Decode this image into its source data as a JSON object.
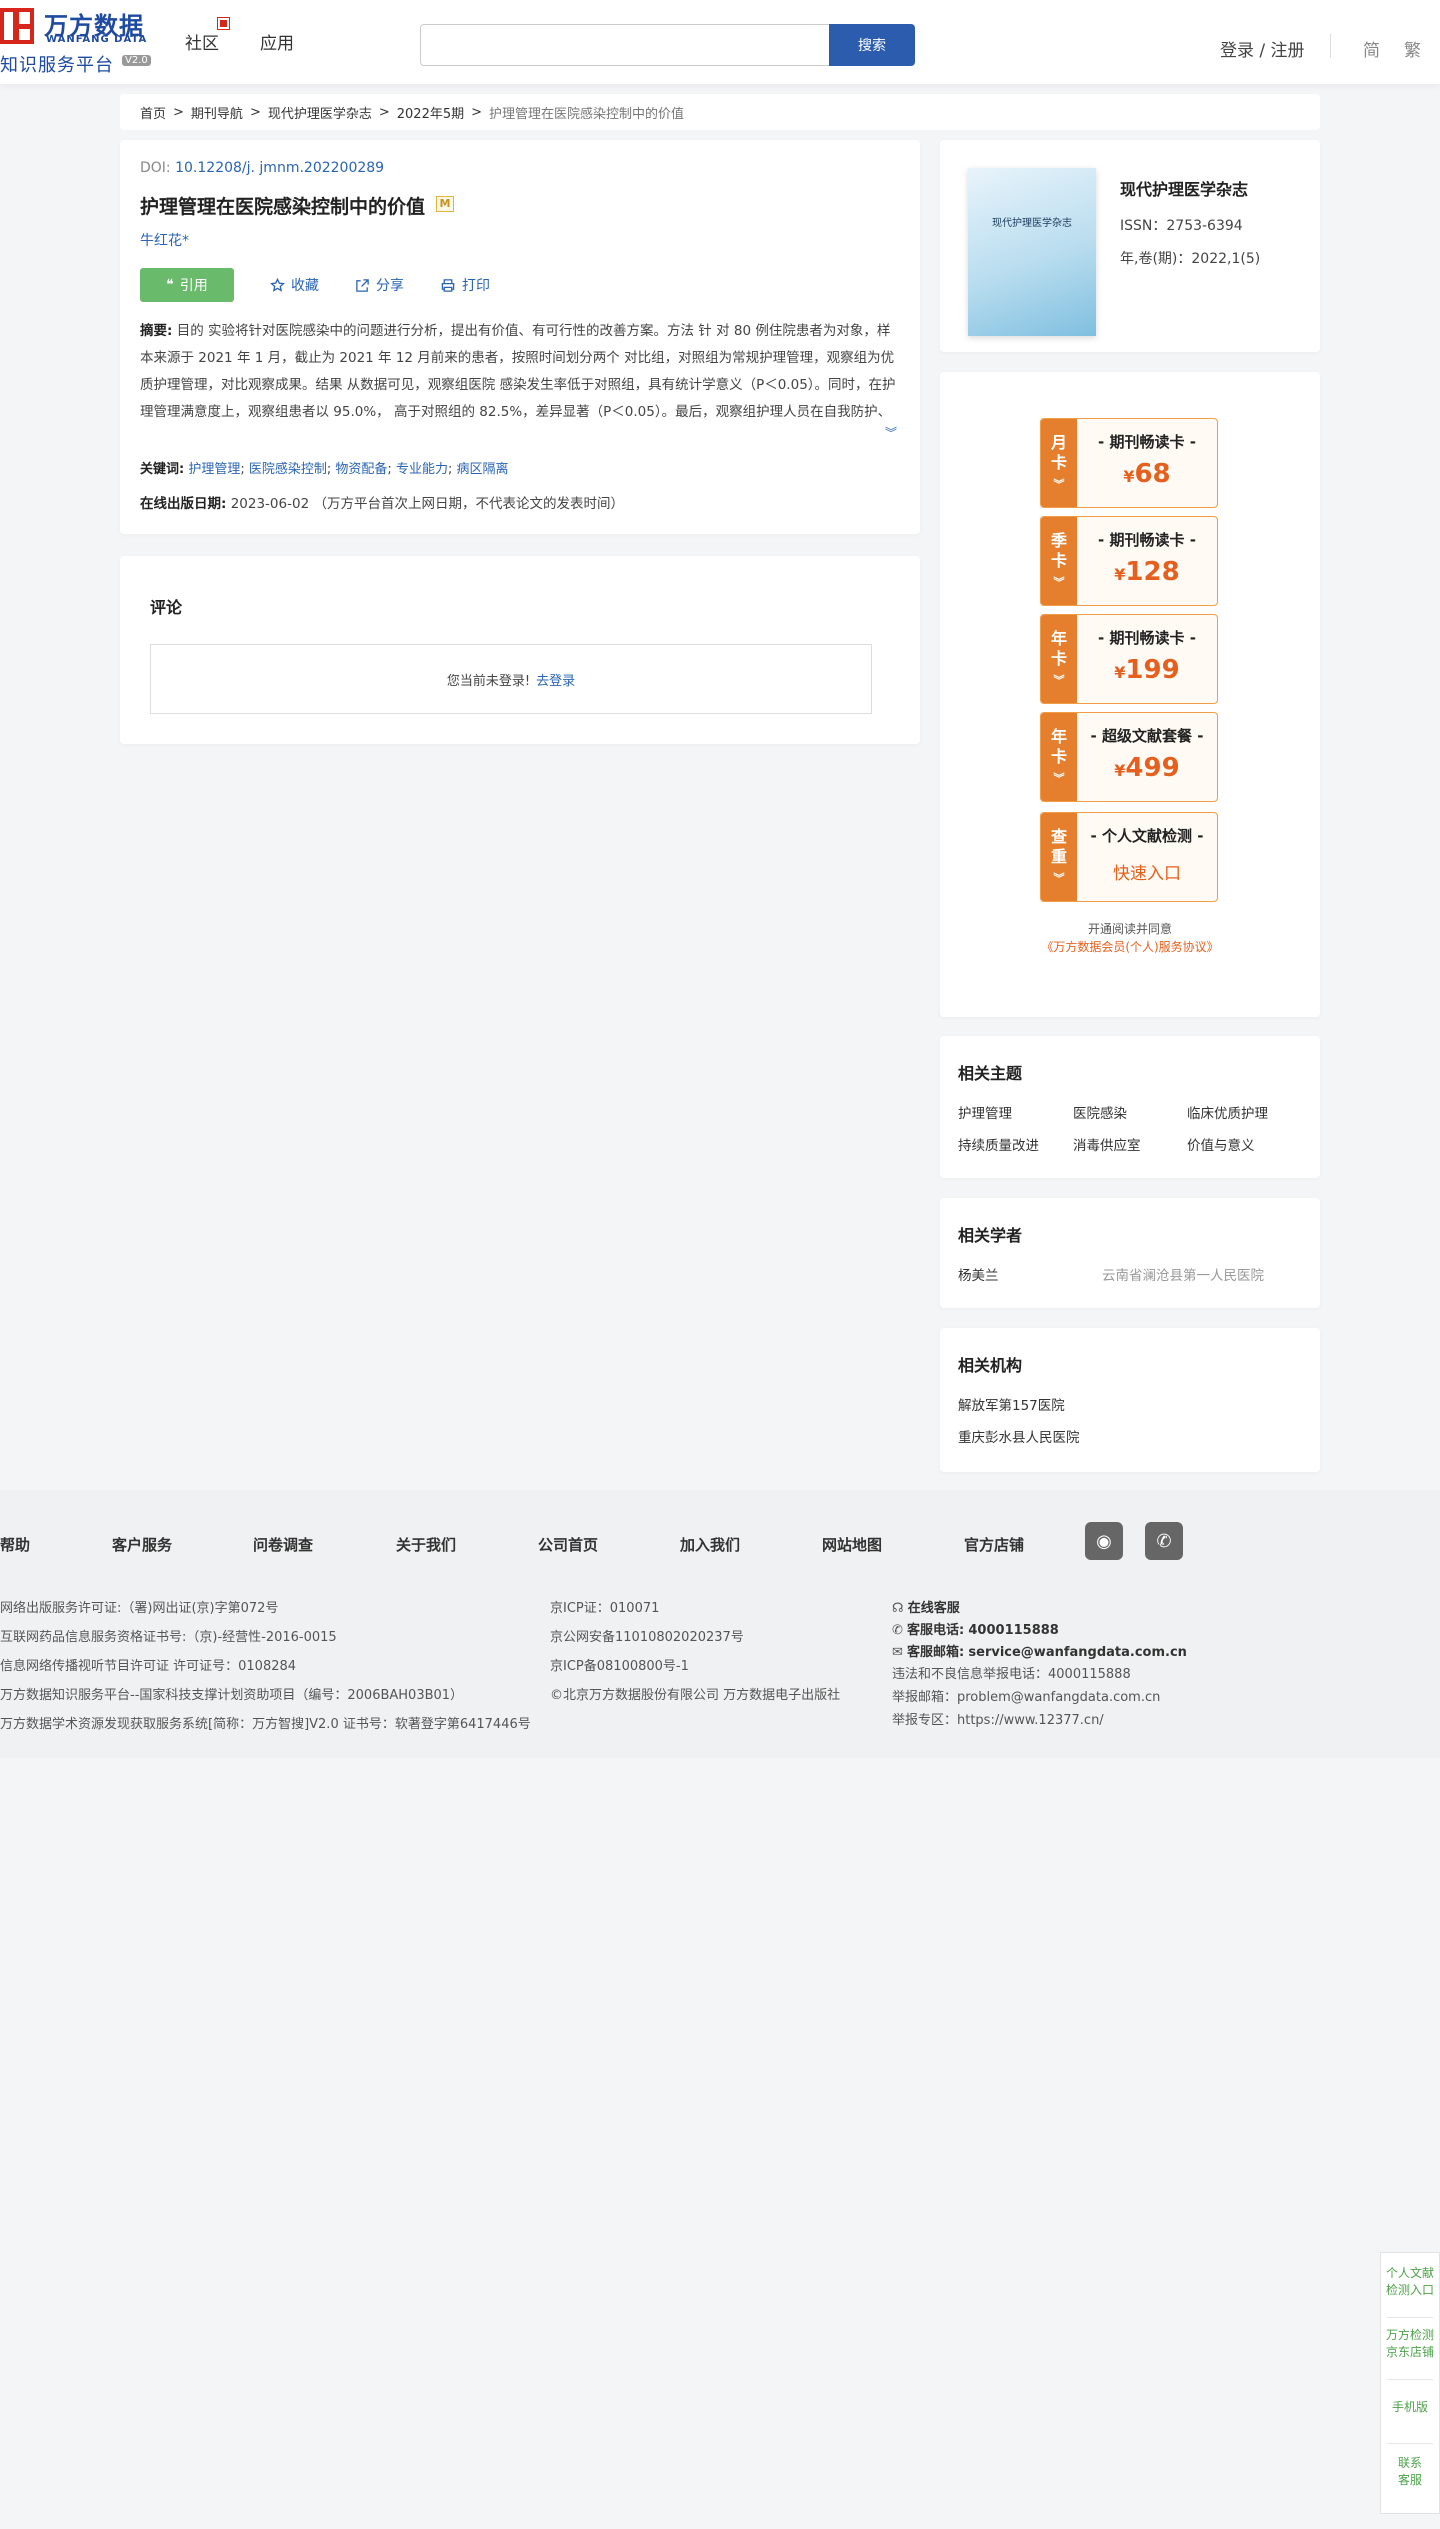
{
  "header": {
    "logo_cn": "万方数据",
    "logo_en": "WANFANG DATA",
    "logo_sub": "知识服务平台",
    "logo_ver": "V2.0",
    "nav": [
      "社区",
      "应用"
    ],
    "search_placeholder": "",
    "search_button": "搜索",
    "login": "登录 / 注册",
    "lang_simplified": "简",
    "lang_traditional": "繁"
  },
  "breadcrumb": {
    "items": [
      "首页",
      "期刊导航",
      "现代护理医学杂志",
      "2022年5期"
    ],
    "separator": ">",
    "current": "护理管理在医院感染控制中的价值"
  },
  "article": {
    "doi_label": "DOI:",
    "doi": "10.12208/j. jmnm.202200289",
    "title": "护理管理在医院感染控制中的价值",
    "m_badge": "M",
    "author": "牛红花*",
    "cite": "引用",
    "favorite": "收藏",
    "share": "分享",
    "print": "打印",
    "abstract_label": "摘要:",
    "abstract": "目的 实验将针对医院感染中的问题进行分析，提出有价值、有可行性的改善方案。方法 针 对 80 例住院患者为对象，样本来源于 2021 年 1 月，截止为 2021 年 12 月前来的患者，按照时间划分两个 对比组，对照组为常规护理管理，观察组为优质护理管理，对比观察成果。结果 从数据可见，观察组医院 感染发生率低于对照组，具有统计学意义（P＜0.05）。同时，在护理管理满意度上，观察组患者以 95.0%， 高于对照组的 82.5%，差异显著（P＜0.05）。最后，观察组护理人员在自我防护、物资配备、专业能力以 及病区隔离评分均高于对照组，对比差异显著。结论 采用优质的医院感...",
    "keywords_label": "关键词:",
    "keywords": [
      "护理管理",
      "医院感染控制",
      "物资配备",
      "专业能力",
      "病区隔离"
    ],
    "pubdate_label": "在线出版日期:",
    "pubdate": "2023-06-02",
    "pubdate_note": "（万方平台首次上网日期，不代表论文的发表时间）"
  },
  "comment": {
    "title": "评论",
    "not_logged_in": "您当前未登录!",
    "login_link": "去登录"
  },
  "journal": {
    "cover_text": "现代护理医学杂志",
    "name": "现代护理医学杂志",
    "issn": "ISSN：2753-6394",
    "volume": "年,卷(期)：2022,1(5)"
  },
  "vip": {
    "cards": [
      {
        "tag": [
          "月",
          "卡"
        ],
        "title": "- 期刊畅读卡 -",
        "price": "68"
      },
      {
        "tag": [
          "季",
          "卡"
        ],
        "title": "- 期刊畅读卡 -",
        "price": "128"
      },
      {
        "tag": [
          "年",
          "卡"
        ],
        "title": "- 期刊畅读卡 -",
        "price": "199"
      },
      {
        "tag": [
          "年",
          "卡"
        ],
        "title": "- 超级文献套餐 -",
        "price": "499"
      },
      {
        "tag": [
          "查",
          "重"
        ],
        "title": "- 个人文献检测 -",
        "quick": "快速入口"
      }
    ],
    "currency": "¥",
    "note_line1": "开通阅读并同意",
    "note_line2": "《万方数据会员(个人)服务协议》"
  },
  "topics": {
    "title": "相关主题",
    "items": [
      "护理管理",
      "医院感染",
      "临床优质护理",
      "持续质量改进",
      "消毒供应室",
      "价值与意义"
    ]
  },
  "scholars": {
    "title": "相关学者",
    "name": "杨美兰",
    "org": "云南省澜沧县第一人民医院"
  },
  "orgs": {
    "title": "相关机构",
    "items": [
      "解放军第157医院",
      "重庆彭水县人民医院"
    ]
  },
  "footer": {
    "links": [
      "帮助",
      "客户服务",
      "问卷调查",
      "关于我们",
      "公司首页",
      "加入我们",
      "网站地图",
      "官方店铺"
    ],
    "col1": [
      "网络出版服务许可证:（署)网出证(京)字第072号",
      "互联网药品信息服务资格证书号:（京)-经营性-2016-0015",
      "信息网络传播视听节目许可证 许可证号：0108284",
      "万方数据知识服务平台--国家科技支撑计划资助项目（编号：2006BAH03B01）",
      "万方数据学术资源发现获取服务系统[简称：万方智搜]V2.0 证书号：软著登字第6417446号"
    ],
    "col2": [
      "京ICP证：010071",
      "京公网安备11010802020237号",
      "京ICP备08100800号-1",
      "©北京万方数据股份有限公司 万方数据电子出版社"
    ],
    "online_service": "在线客服",
    "phone_label": "客服电话:",
    "phone": "4000115888",
    "email_label": "客服邮箱:",
    "email": "service@wanfangdata.com.cn",
    "report_phone": "违法和不良信息举报电话：4000115888",
    "report_email": "举报邮箱：problem@wanfangdata.com.cn",
    "report_zone": "举报专区：https://www.12377.cn/"
  },
  "float": {
    "items": [
      "个人文献检测入口",
      "万方检测京东店铺",
      "手机版",
      "联系客服"
    ]
  },
  "colors": {
    "brand_blue": "#2b5cae",
    "link_blue": "#2a64b4",
    "cite_green": "#6aba6c",
    "vip_orange": "#e57f2d",
    "logo_red": "#d7261c"
  }
}
